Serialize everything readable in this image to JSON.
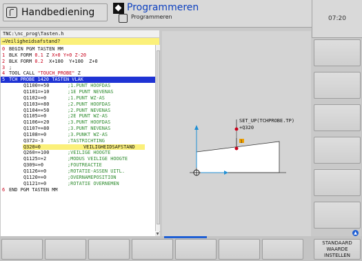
{
  "header": {
    "mode_left": "Handbediening",
    "mode_right": "Programmeren",
    "mode_right_sub": "Programmeren",
    "clock": "07:20"
  },
  "editor": {
    "path": "TNC:\\nc_prog\\Tasten.h",
    "prompt": "→Veiligheidsafstand?",
    "lines": [
      {
        "n": "0",
        "c": "BEGIN PGM TASTEN MM"
      },
      {
        "n": "1",
        "c": "BLK FORM 0.1 Z X+0 Y+0 Z-20"
      },
      {
        "n": "2",
        "c": "BLK FORM 0.2  X+100  Y+100  Z+0"
      },
      {
        "n": "3",
        "c": ";"
      },
      {
        "n": "4",
        "c": "TOOL CALL \"TOUCH_PROBE\" Z"
      },
      {
        "n": "5",
        "c": "TCH PROBE 1420 TASTEN VLAK"
      },
      {
        "q": "Q1100=+50",
        "cm": ";1.PUNT HOOFDAS"
      },
      {
        "q": "Q1101=+10",
        "cm": ";1E PUNT NEVENAS"
      },
      {
        "q": "Q1102=+0",
        "cm": ";1.PUNT WZ-AS"
      },
      {
        "q": "Q1103=+80",
        "cm": ";2.PUNT HOOFDAS"
      },
      {
        "q": "Q1104=+50",
        "cm": ";2.PUNT NEVENAS"
      },
      {
        "q": "Q1105=+0",
        "cm": ";2E PUNT WZ-AS"
      },
      {
        "q": "Q1106=+20",
        "cm": ";3.PUNT HOOFDAS"
      },
      {
        "q": "Q1107=+80",
        "cm": ";3.PUNT NEVENAS"
      },
      {
        "q": "Q1108=+0",
        "cm": ";3.PUNKT WZ-AS"
      },
      {
        "q": "Q372=-3",
        "cm": ";TASTRICHTING"
      },
      {
        "q": "Q320=0",
        "cm": "VEILIGHEIDSAFSTAND"
      },
      {
        "q": "Q260=+100",
        "cm": ";VEILIGE HOOGTE"
      },
      {
        "q": "Q1125=+2",
        "cm": ";MODUS VEILIGE HOOGTE"
      },
      {
        "q": "Q309=+0",
        "cm": ";FOUTREACTIE"
      },
      {
        "q": "Q1126=+0",
        "cm": ";ROTATIE-ASSEN UITL."
      },
      {
        "q": "Q1120=+0",
        "cm": ";OVERNAMEPOSITION"
      },
      {
        "q": "Q1121=+0",
        "cm": ";ROTATIE OVERNEMEN"
      },
      {
        "n": "6",
        "c": "END PGM TASTEN MM"
      }
    ]
  },
  "graphic": {
    "label_line1": "SET_UP(TCHPROBE.TP)",
    "label_line2": "+Q320",
    "marker": "1"
  },
  "softkeys": {
    "bottom_last_line1": "STANDAARD",
    "bottom_last_line2": "WAARDE",
    "bottom_last_line3": "INSTELLEN"
  },
  "colors": {
    "selection": "#1f33d4",
    "highlight": "#fbf07a",
    "comment": "#2e8b2e",
    "line_number": "#c8001a",
    "arrow": "#1f8fd4"
  }
}
